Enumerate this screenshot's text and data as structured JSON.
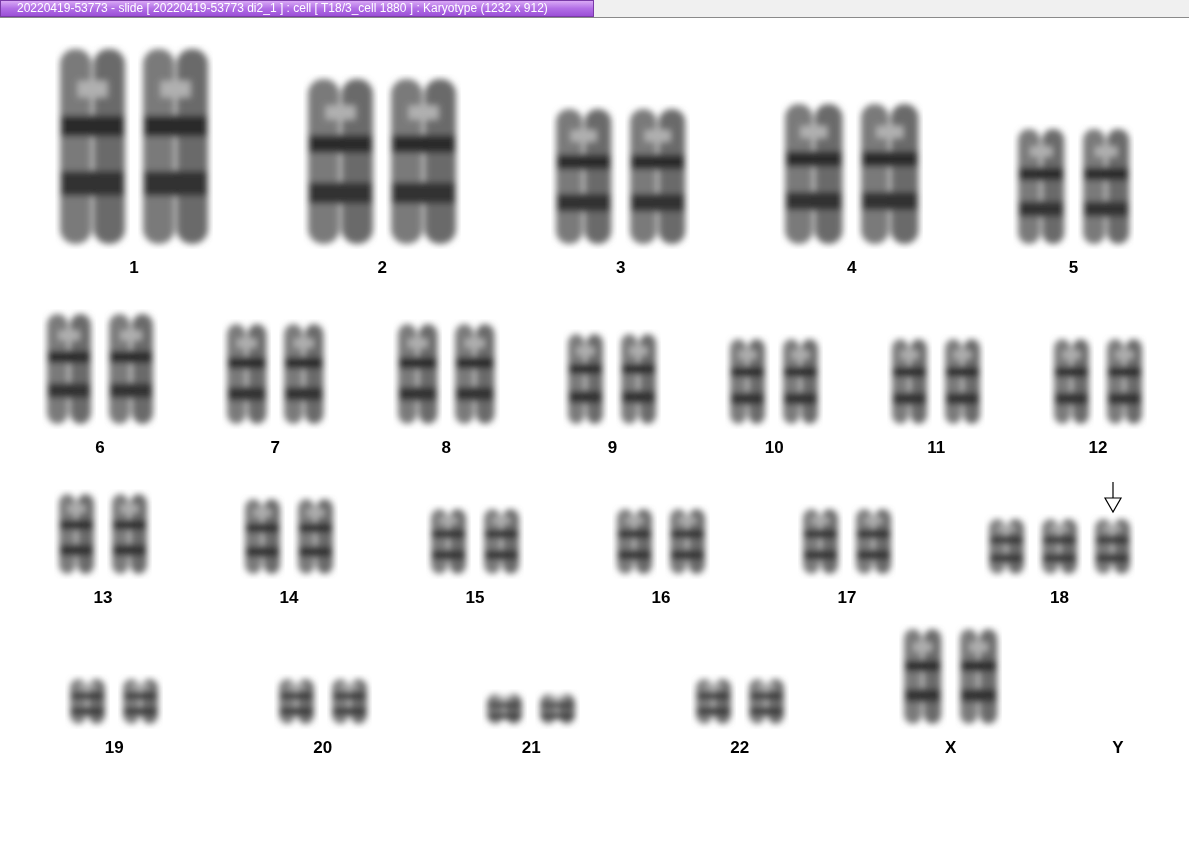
{
  "window": {
    "title": "20220419-53773 - slide [ 20220419-53773 di2_1 ] : cell [ T18/3_cell 1880 ] : Karyotype  (1232 x 912)"
  },
  "rows": [
    {
      "groups": [
        {
          "label": "1",
          "chromosomes": [
            {
              "marked": false
            },
            {
              "marked": false
            }
          ]
        },
        {
          "label": "2",
          "chromosomes": [
            {
              "marked": false
            },
            {
              "marked": false
            }
          ]
        },
        {
          "label": "3",
          "chromosomes": [
            {
              "marked": false
            },
            {
              "marked": false
            }
          ]
        },
        {
          "label": "4",
          "chromosomes": [
            {
              "marked": false
            },
            {
              "marked": false
            }
          ]
        },
        {
          "label": "5",
          "chromosomes": [
            {
              "marked": false
            },
            {
              "marked": false
            }
          ]
        }
      ]
    },
    {
      "groups": [
        {
          "label": "6",
          "chromosomes": [
            {
              "marked": false
            },
            {
              "marked": false
            }
          ]
        },
        {
          "label": "7",
          "chromosomes": [
            {
              "marked": false
            },
            {
              "marked": false
            }
          ]
        },
        {
          "label": "8",
          "chromosomes": [
            {
              "marked": false
            },
            {
              "marked": false
            }
          ]
        },
        {
          "label": "9",
          "chromosomes": [
            {
              "marked": false
            },
            {
              "marked": false
            }
          ]
        },
        {
          "label": "10",
          "chromosomes": [
            {
              "marked": false
            },
            {
              "marked": false
            }
          ]
        },
        {
          "label": "11",
          "chromosomes": [
            {
              "marked": false
            },
            {
              "marked": false
            }
          ]
        },
        {
          "label": "12",
          "chromosomes": [
            {
              "marked": false
            },
            {
              "marked": false
            }
          ]
        }
      ]
    },
    {
      "groups": [
        {
          "label": "13",
          "chromosomes": [
            {
              "marked": false
            },
            {
              "marked": false
            }
          ]
        },
        {
          "label": "14",
          "chromosomes": [
            {
              "marked": false
            },
            {
              "marked": false
            }
          ]
        },
        {
          "label": "15",
          "chromosomes": [
            {
              "marked": false
            },
            {
              "marked": false
            }
          ]
        },
        {
          "label": "16",
          "chromosomes": [
            {
              "marked": false
            },
            {
              "marked": false
            }
          ]
        },
        {
          "label": "17",
          "chromosomes": [
            {
              "marked": false
            },
            {
              "marked": false
            }
          ]
        },
        {
          "label": "18",
          "chromosomes": [
            {
              "marked": false
            },
            {
              "marked": false
            },
            {
              "marked": true
            }
          ]
        }
      ]
    },
    {
      "groups": [
        {
          "label": "19",
          "chromosomes": [
            {
              "marked": false
            },
            {
              "marked": false
            }
          ]
        },
        {
          "label": "20",
          "chromosomes": [
            {
              "marked": false
            },
            {
              "marked": false
            }
          ]
        },
        {
          "label": "21",
          "chromosomes": [
            {
              "marked": false
            },
            {
              "marked": false
            }
          ]
        },
        {
          "label": "22",
          "chromosomes": [
            {
              "marked": false
            },
            {
              "marked": false
            }
          ]
        },
        {
          "label": "X",
          "chromosomes": [
            {
              "marked": false
            },
            {
              "marked": false
            }
          ]
        },
        {
          "label": "Y"
        }
      ]
    }
  ]
}
